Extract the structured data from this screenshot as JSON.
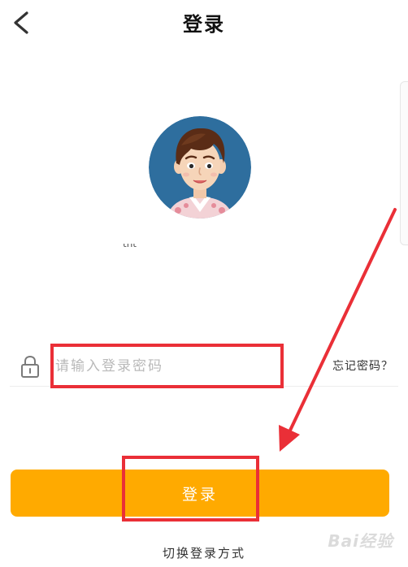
{
  "header": {
    "title": "登录",
    "back_icon": "chevron-left-icon"
  },
  "profile": {
    "username": "tnt",
    "avatar": "cartoon-boy-avatar"
  },
  "password_field": {
    "placeholder": "请输入登录密码",
    "value": "",
    "icon": "lock-icon"
  },
  "forgot_password": {
    "label": "忘记密码？"
  },
  "login_button": {
    "label": "登录",
    "color": "#FFAA00"
  },
  "switch_method": {
    "label": "切换登录方式"
  },
  "annotations": {
    "highlight_color": "#EA2F37"
  },
  "watermark": {
    "text": "Bai经验"
  }
}
